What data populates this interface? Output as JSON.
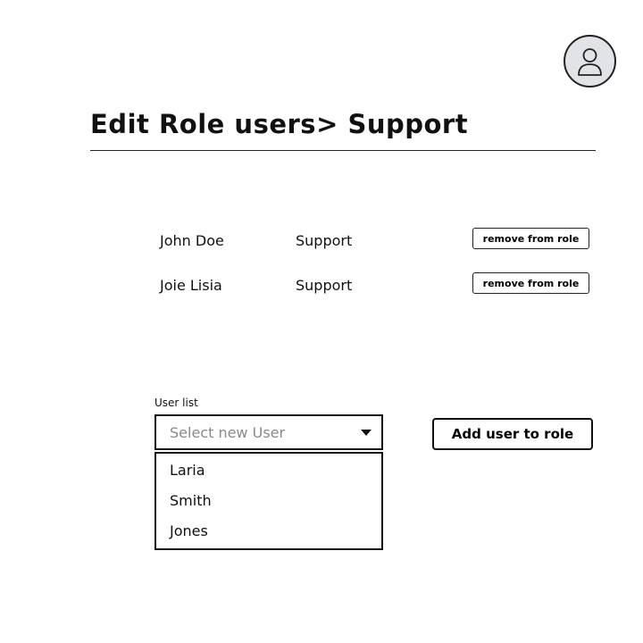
{
  "header": {
    "avatar_icon": "user-avatar-icon",
    "title": "Edit Role users> Support"
  },
  "members": [
    {
      "name": "John Doe",
      "role": "Support",
      "action_label": "remove from role"
    },
    {
      "name": "Joie Lisia",
      "role": "Support",
      "action_label": "remove from role"
    }
  ],
  "add_user": {
    "label": "User list",
    "placeholder": "Select new User",
    "options": [
      "Laria",
      "Smith",
      "Jones"
    ],
    "button_label": "Add user to role"
  },
  "colors": {
    "avatar_bg": "#e2e3e6",
    "placeholder_text": "#8a8a8a",
    "border": "#111111"
  }
}
